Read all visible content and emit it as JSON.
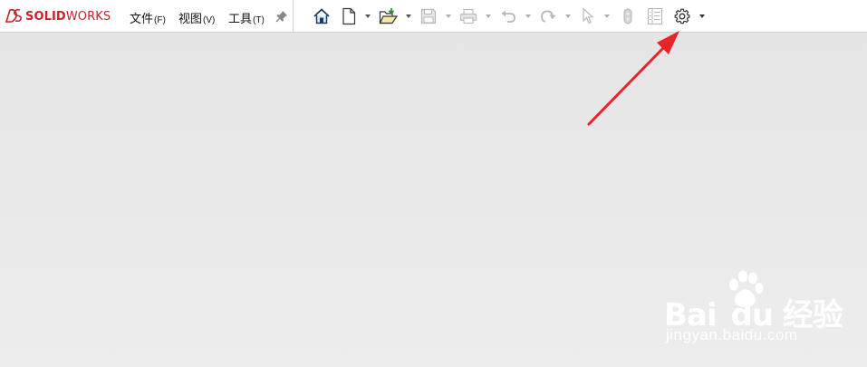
{
  "app": {
    "logo_text_bold": "SOLID",
    "logo_text_rest": "WORKS"
  },
  "menu": {
    "file_label": "文件",
    "file_key": "(F)",
    "view_label": "视图",
    "view_key": "(V)",
    "tools_label": "工具",
    "tools_key": "(T)"
  },
  "toolbar": {
    "buttons": [
      {
        "icon": "home-icon",
        "enabled": true
      },
      {
        "icon": "new-document-icon",
        "enabled": true
      },
      {
        "icon": "open-folder-icon",
        "enabled": true
      },
      {
        "icon": "save-icon",
        "enabled": false
      },
      {
        "icon": "print-icon",
        "enabled": false
      },
      {
        "icon": "undo-icon",
        "enabled": false
      },
      {
        "icon": "redo-icon",
        "enabled": false
      },
      {
        "icon": "select-pointer-icon",
        "enabled": false
      },
      {
        "icon": "rebuild-icon",
        "enabled": false
      },
      {
        "icon": "file-properties-icon",
        "enabled": false
      },
      {
        "icon": "options-gear-icon",
        "enabled": true
      }
    ]
  },
  "colors": {
    "brand": "#cc1f2b",
    "arrow": "#e8232a",
    "toolbar_bg": "#ffffff",
    "canvas_bg": "#e9e9e9"
  },
  "watermark": {
    "brand_left": "Bai",
    "brand_right": "du",
    "site_name": "经验",
    "url": "jingyan.baidu.com"
  }
}
